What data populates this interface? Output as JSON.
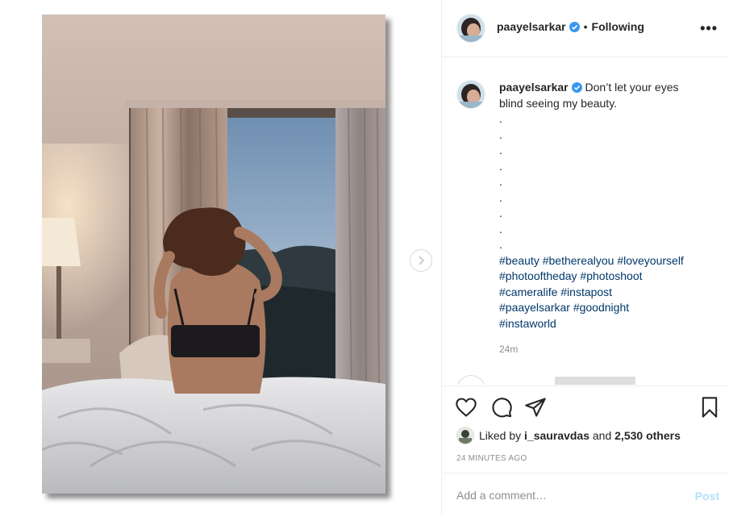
{
  "post": {
    "username": "paayelsarkar",
    "follow_status": "Following",
    "more_label": "•••",
    "caption_line1": "Don’t let your eyes",
    "caption_line2": "blind seeing my beauty.",
    "dots": [
      ".",
      ".",
      ".",
      ".",
      ".",
      ".",
      ".",
      ".",
      "."
    ],
    "hashtag_lines": [
      "#beauty #betherealyou #loveyourself",
      "#photooftheday #photoshoot",
      "#cameralife #instapost",
      "#paayelsarkar #goodnight",
      "#instaworld"
    ],
    "caption_age": "24m",
    "liked_by_prefix": "Liked by",
    "liked_by_user": "i_sauravdas",
    "liked_by_and": "and",
    "liked_by_others": "2,530 others",
    "timestamp": "24 MINUTES AGO",
    "comment_placeholder": "Add a comment…",
    "post_label": "Post"
  },
  "icons": {
    "like": "heart-icon",
    "comment": "comment-icon",
    "share": "paper-plane-icon",
    "save": "bookmark-icon",
    "verified": "verified-badge-icon",
    "next": "chevron-right-icon"
  },
  "colors": {
    "verified": "#3897f0",
    "hashtag": "#00376b",
    "post_button_disabled": "#b2dffc",
    "muted": "#8e8e8e"
  }
}
